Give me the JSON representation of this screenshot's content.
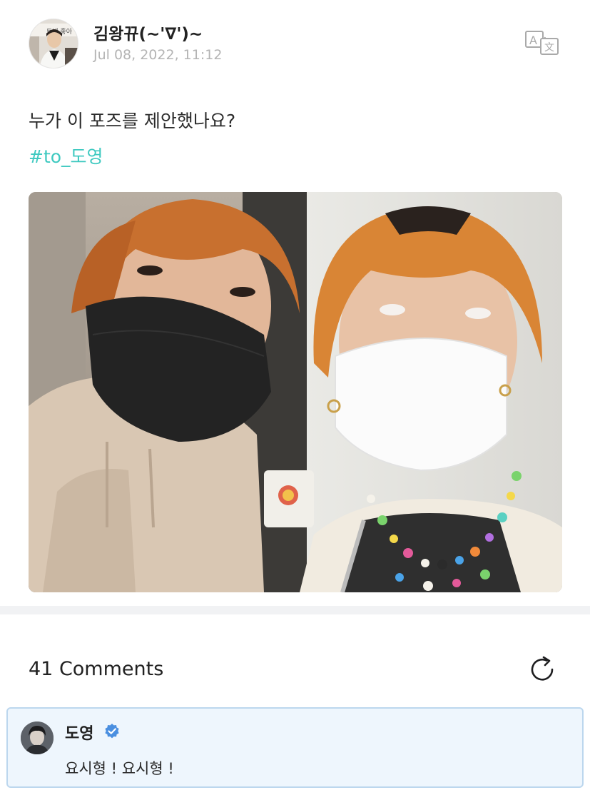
{
  "post": {
    "author": "김왕뀨(~'∇')~",
    "date": "Jul 08, 2022, 11:12",
    "text": "누가 이 포즈를 제안했나요?",
    "hashtag": "#to_도영",
    "avatar_sign_text": "트네 좋아"
  },
  "comments": {
    "count_label": "41 Comments",
    "items": [
      {
        "author": "도영",
        "verified": true,
        "text": "요시형 ! 요시형 !"
      }
    ]
  },
  "colors": {
    "hashtag": "#3ec9c0",
    "verified_badge": "#4a8fe0",
    "highlight_bg": "#eef6fd",
    "highlight_border": "#bcd7ee"
  },
  "icons": {
    "translate": "translate-icon",
    "refresh": "refresh-icon",
    "verified": "verified-badge-icon"
  }
}
